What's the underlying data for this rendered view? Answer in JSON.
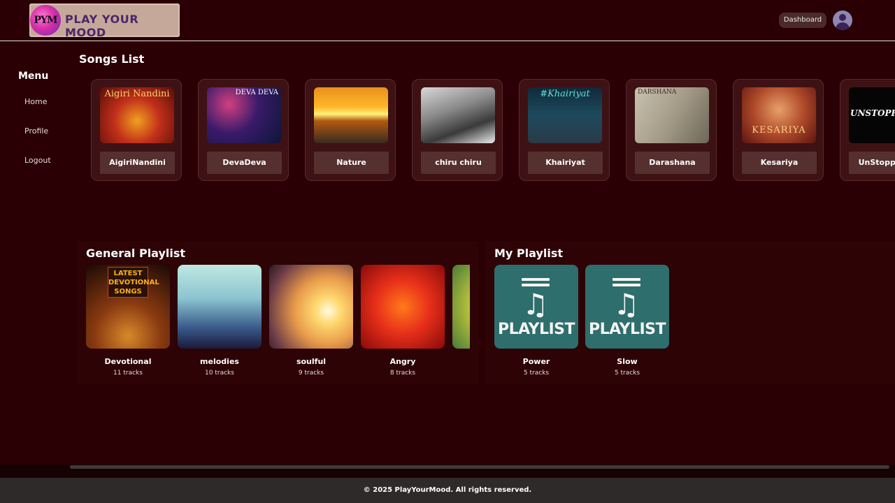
{
  "header": {
    "logo_text": "PLAY YOUR MOOD",
    "logo_monogram": "PYM",
    "dashboard_label": "Dashboard"
  },
  "sidebar": {
    "title": "Menu",
    "items": [
      {
        "label": "Home"
      },
      {
        "label": "Profile"
      },
      {
        "label": "Logout"
      }
    ]
  },
  "songs": {
    "title": "Songs List",
    "items": [
      {
        "label": "AigiriNandini",
        "art_text": "Aigiri Nandini"
      },
      {
        "label": "DevaDeva",
        "art_text": "DEVA DEVA"
      },
      {
        "label": "Nature",
        "art_text": ""
      },
      {
        "label": "chiru chiru",
        "art_text": ""
      },
      {
        "label": "Khairiyat",
        "art_text": "#Khairiyat"
      },
      {
        "label": "Darashana",
        "art_text": "DARSHANA"
      },
      {
        "label": "Kesariya",
        "art_text": "KESARIYA"
      },
      {
        "label": "UnStoppable",
        "art_text": "UNSTOPPABLE"
      }
    ]
  },
  "general_playlist": {
    "title": "General Playlist",
    "items": [
      {
        "name": "Devotional",
        "tracks": "11 tracks",
        "art_text": "LATEST DEVOTIONAL SONGS"
      },
      {
        "name": "melodies",
        "tracks": "10 tracks"
      },
      {
        "name": "soulful",
        "tracks": "9 tracks"
      },
      {
        "name": "Angry",
        "tracks": "8 tracks"
      },
      {
        "name": "",
        "tracks": ""
      }
    ]
  },
  "my_playlist": {
    "title": "My Playlist",
    "items": [
      {
        "name": "Power",
        "tracks": "5 tracks",
        "art_word": "PLAYLIST"
      },
      {
        "name": "Slow",
        "tracks": "5 tracks",
        "art_word": "PLAYLIST"
      }
    ]
  },
  "footer": {
    "text": "© 2025 PlayYourMood. All rights reserved."
  },
  "colors": {
    "background": "#2a0004",
    "card": "#3e1214",
    "label_bg": "#55302f",
    "playlist_teal": "#2e6e6c",
    "footer_bg": "#2e2a2a"
  }
}
